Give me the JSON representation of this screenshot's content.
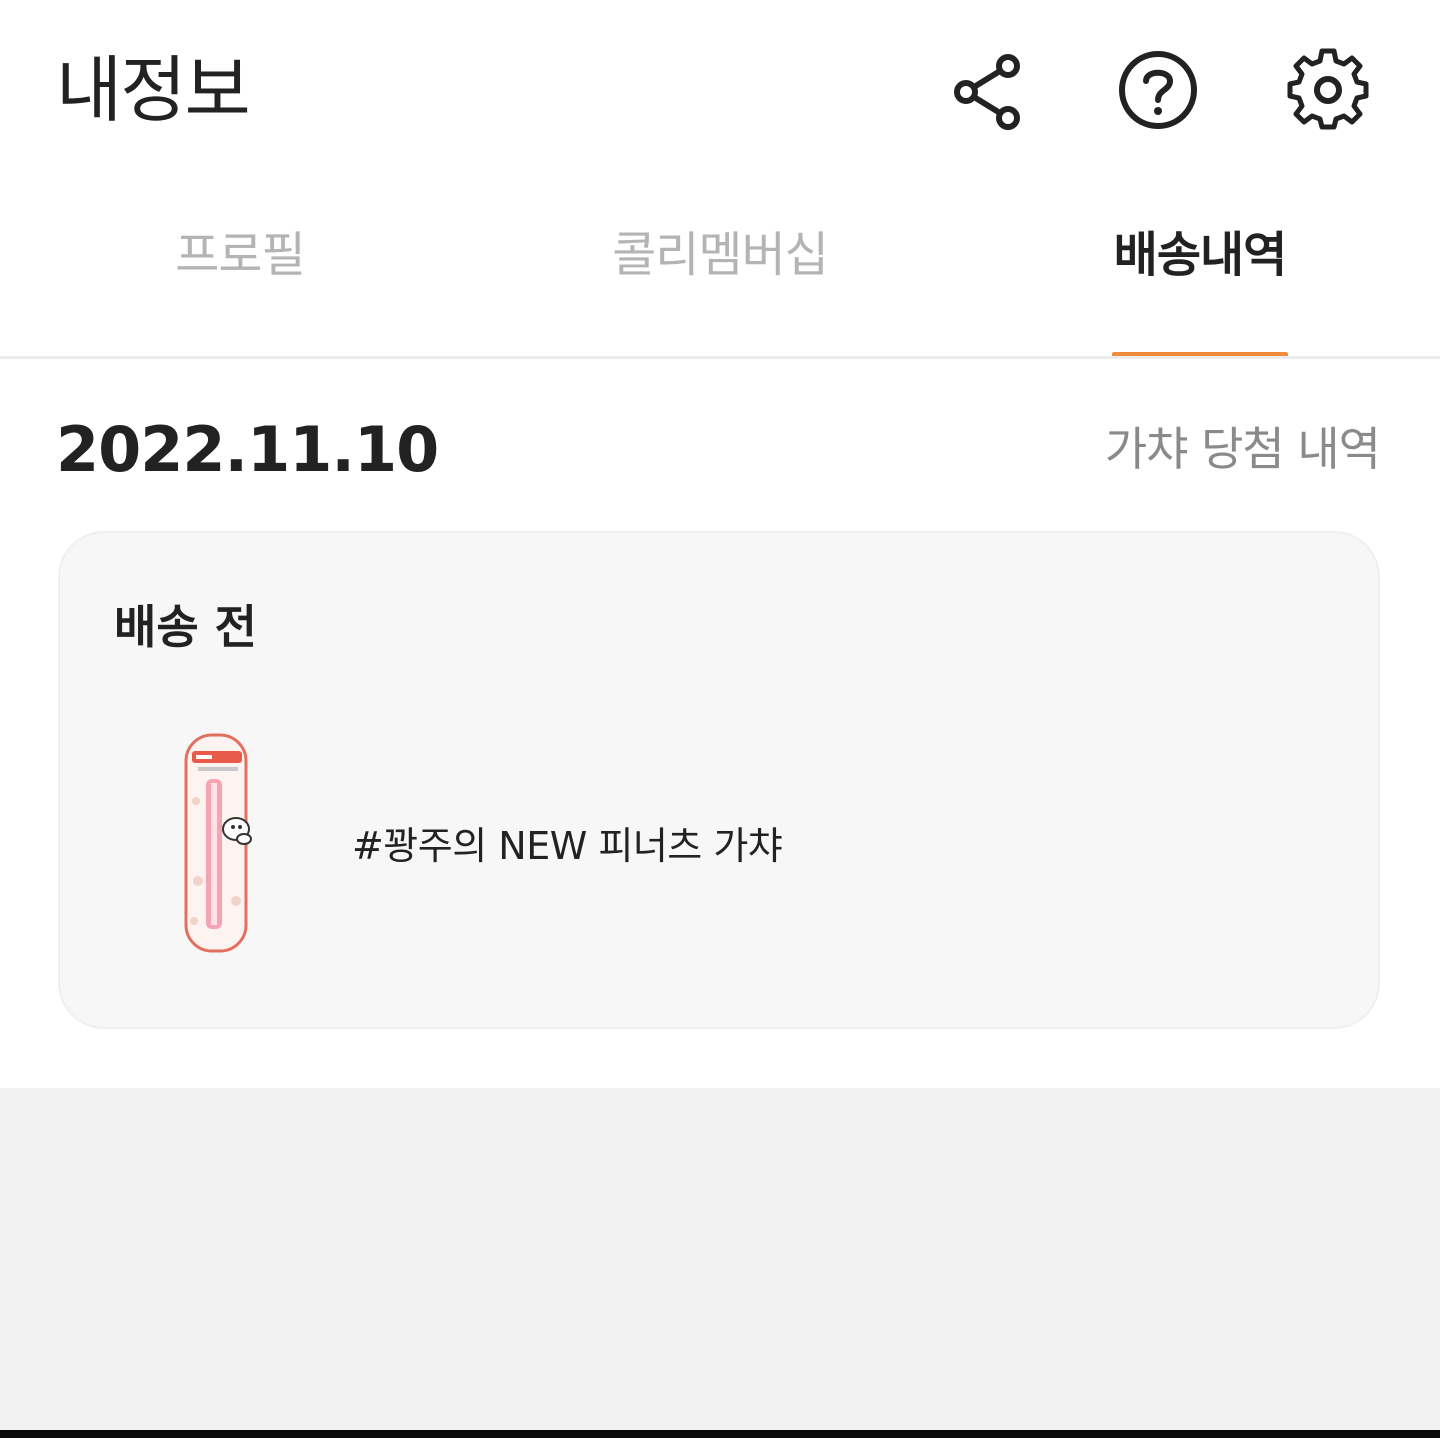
{
  "header": {
    "title": "내정보",
    "icons": [
      "share-icon",
      "help-icon",
      "gear-icon"
    ]
  },
  "tabs": {
    "items": [
      {
        "label": "프로필",
        "active": false
      },
      {
        "label": "콜리멤버십",
        "active": false
      },
      {
        "label": "배송내역",
        "active": true
      }
    ],
    "accent_color": "#f08a3c"
  },
  "order": {
    "date": "2022.11.10",
    "gacha_link_label": "가챠 당첨 내역",
    "card": {
      "status": "배송 전",
      "product_name": "#꽝주의 NEW 피너츠 가챠",
      "product_image": "pink-pen-package"
    }
  }
}
